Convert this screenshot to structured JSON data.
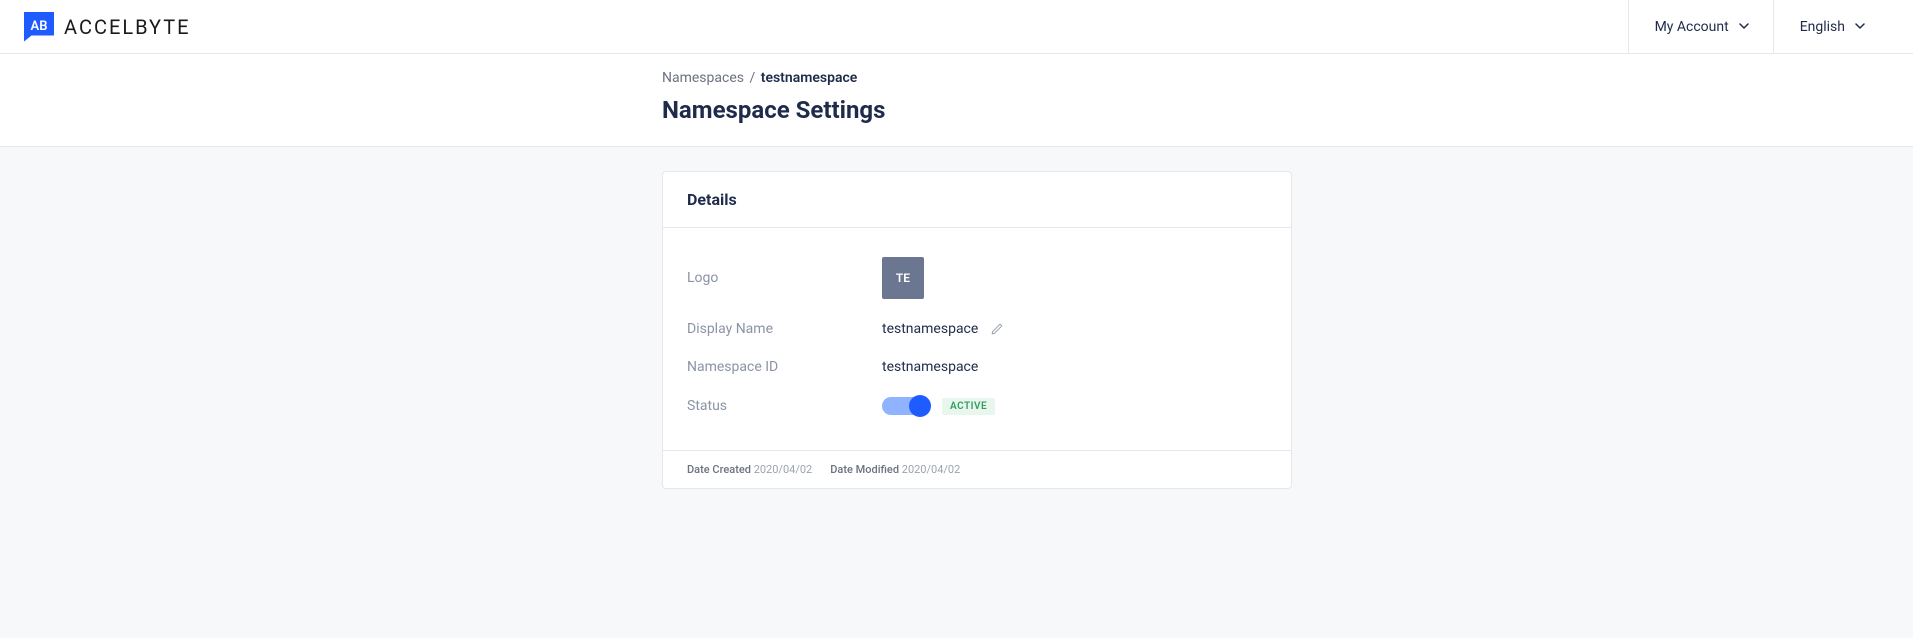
{
  "header": {
    "brand": "ACCELBYTE",
    "logo_mark": "AB",
    "account_label": "My Account",
    "language_label": "English"
  },
  "breadcrumb": {
    "parent": "Namespaces",
    "current": "testnamespace"
  },
  "page_title": "Namespace Settings",
  "card": {
    "title": "Details",
    "fields": {
      "logo_label": "Logo",
      "logo_tile": "TE",
      "display_name_label": "Display Name",
      "display_name_value": "testnamespace",
      "namespace_id_label": "Namespace ID",
      "namespace_id_value": "testnamespace",
      "status_label": "Status",
      "status_badge": "ACTIVE"
    },
    "footer": {
      "created_label": "Date Created",
      "created_value": "2020/04/02",
      "modified_label": "Date Modified",
      "modified_value": "2020/04/02"
    }
  }
}
